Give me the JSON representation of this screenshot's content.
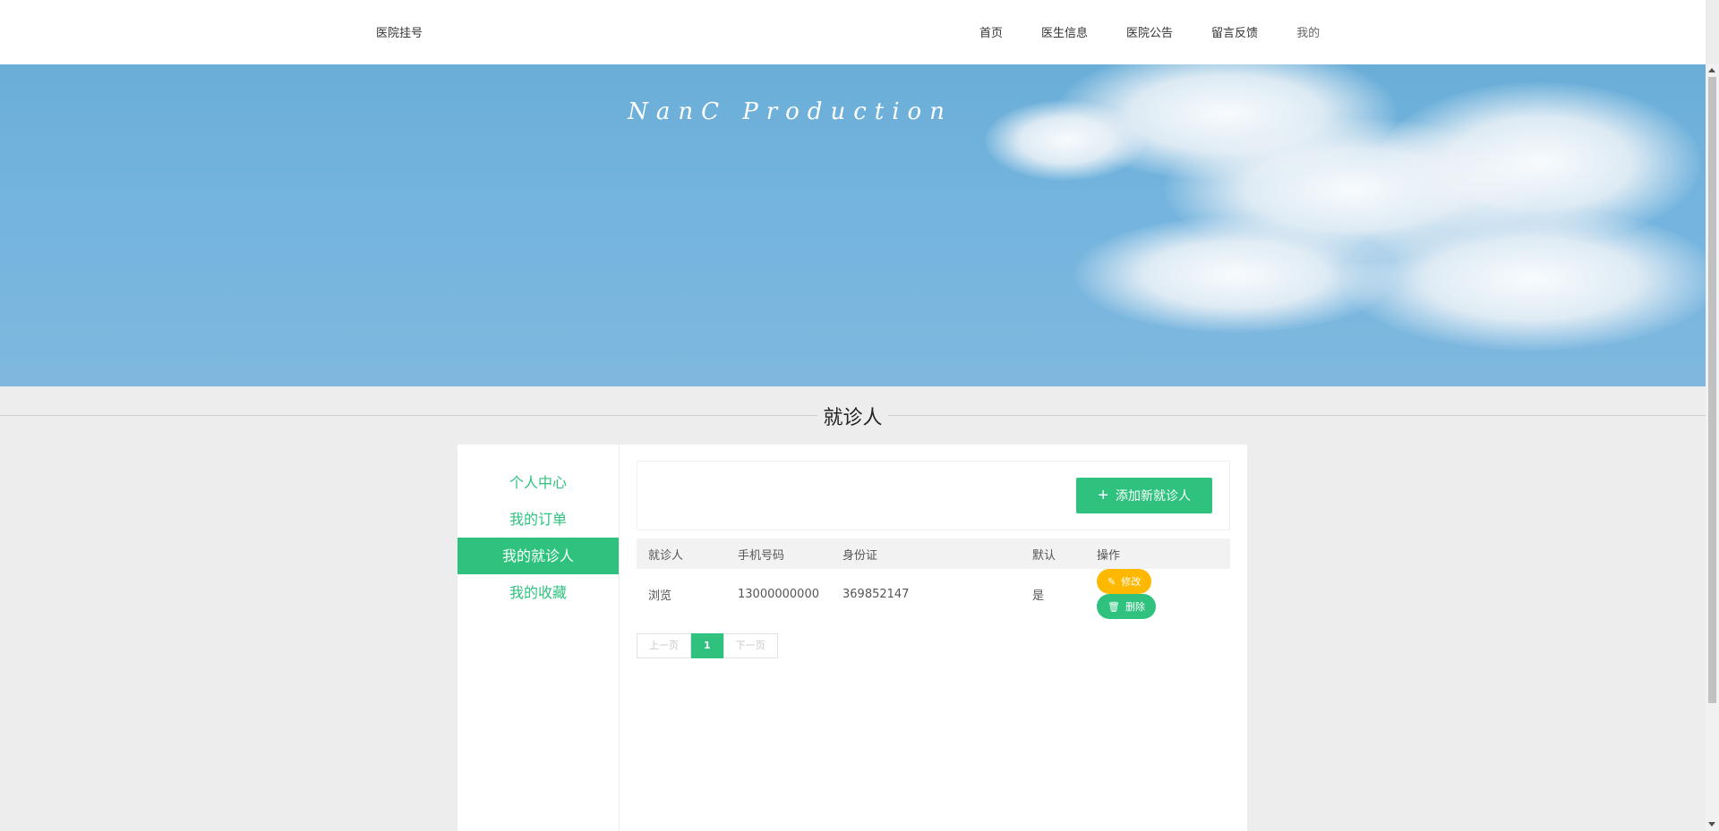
{
  "nav": {
    "brand": "医院挂号",
    "links": [
      "首页",
      "医生信息",
      "医院公告",
      "留言反馈",
      "我的"
    ]
  },
  "banner": {
    "title": "NanC  Production"
  },
  "section": {
    "title": "就诊人"
  },
  "sidebar": {
    "items": [
      "个人中心",
      "我的订单",
      "我的就诊人",
      "我的收藏"
    ],
    "active_index": 2
  },
  "toolbar": {
    "add_label": "添加新就诊人"
  },
  "table": {
    "headers": [
      "就诊人",
      "手机号码",
      "身份证",
      "默认",
      "操作"
    ],
    "rows": [
      {
        "name": "浏览",
        "phone": "13000000000",
        "id_card": "369852147",
        "default": "是",
        "edit_label": "修改",
        "delete_label": "删除"
      }
    ]
  },
  "pager": {
    "prev": "上一页",
    "current": "1",
    "next": "下一页"
  },
  "colors": {
    "accent": "#2ec27e",
    "warning": "#ffb800"
  }
}
